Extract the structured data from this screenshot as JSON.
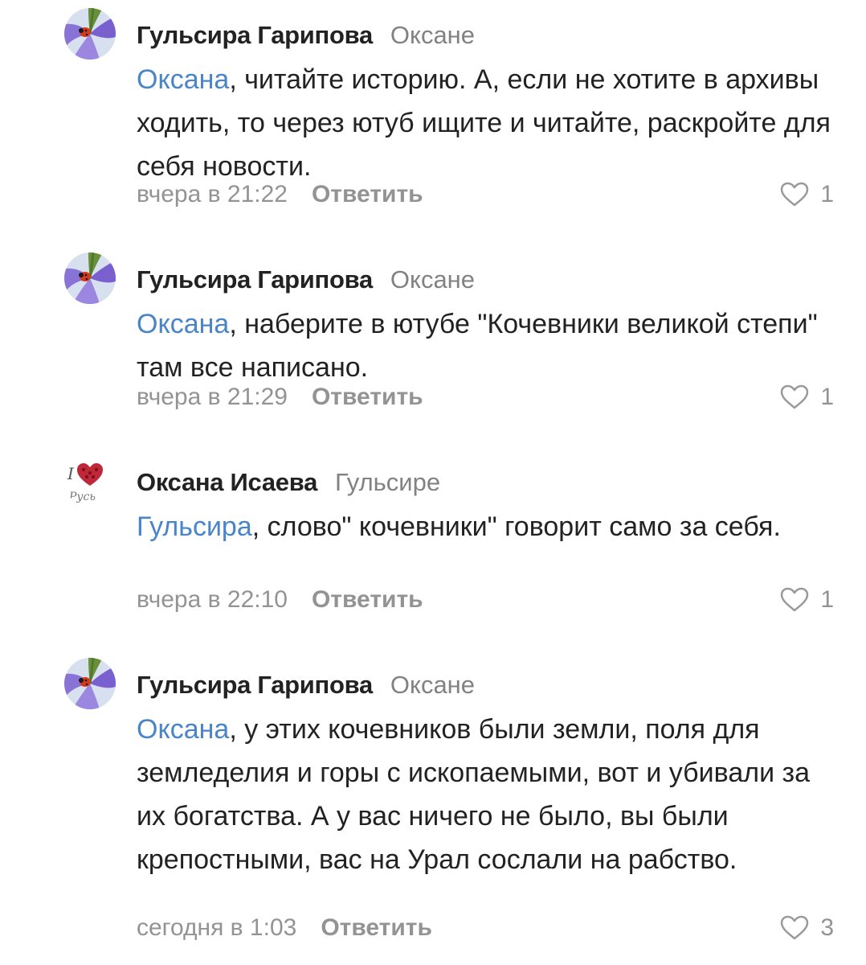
{
  "colors": {
    "mention": "#4a84c9",
    "muted": "#939393",
    "text": "#222222"
  },
  "comments": [
    {
      "author": "Гульсира Гарипова",
      "reply_to": "Оксане",
      "mention": "Оксана",
      "text": ", читайте историю. А, если не хотите в архивы ходить, то через ютуб ищите и читайте, раскройте для себя новости.",
      "time": "вчера в 21:22",
      "reply_label": "Ответить",
      "likes": "1",
      "avatar_icon": "ladybug-flower-avatar"
    },
    {
      "author": "Гульсира Гарипова",
      "reply_to": "Оксане",
      "mention": "Оксана",
      "text": ", наберите в ютубе \"Кочевники великой степи\" там все написано.",
      "time": "вчера в 21:29",
      "reply_label": "Ответить",
      "likes": "1",
      "avatar_icon": "ladybug-flower-avatar"
    },
    {
      "author": "Оксана Исаева",
      "reply_to": "Гульсире",
      "mention": "Гульсира",
      "text": ", слово\" кочевники\" говорит само за себя.",
      "time": "вчера в 22:10",
      "reply_label": "Ответить",
      "likes": "1",
      "avatar_icon": "i-love-russia-avatar"
    },
    {
      "author": "Гульсира Гарипова",
      "reply_to": "Оксане",
      "mention": "Оксана",
      "text": ", у этих кочевников были земли, поля для земледелия и горы с ископаемыми, вот и убивали за их богатства. А у вас ничего не было, вы были крепостными, вас на Урал сослали на рабство.",
      "time": "сегодня в 1:03",
      "reply_label": "Ответить",
      "likes": "3",
      "avatar_icon": "ladybug-flower-avatar"
    }
  ]
}
